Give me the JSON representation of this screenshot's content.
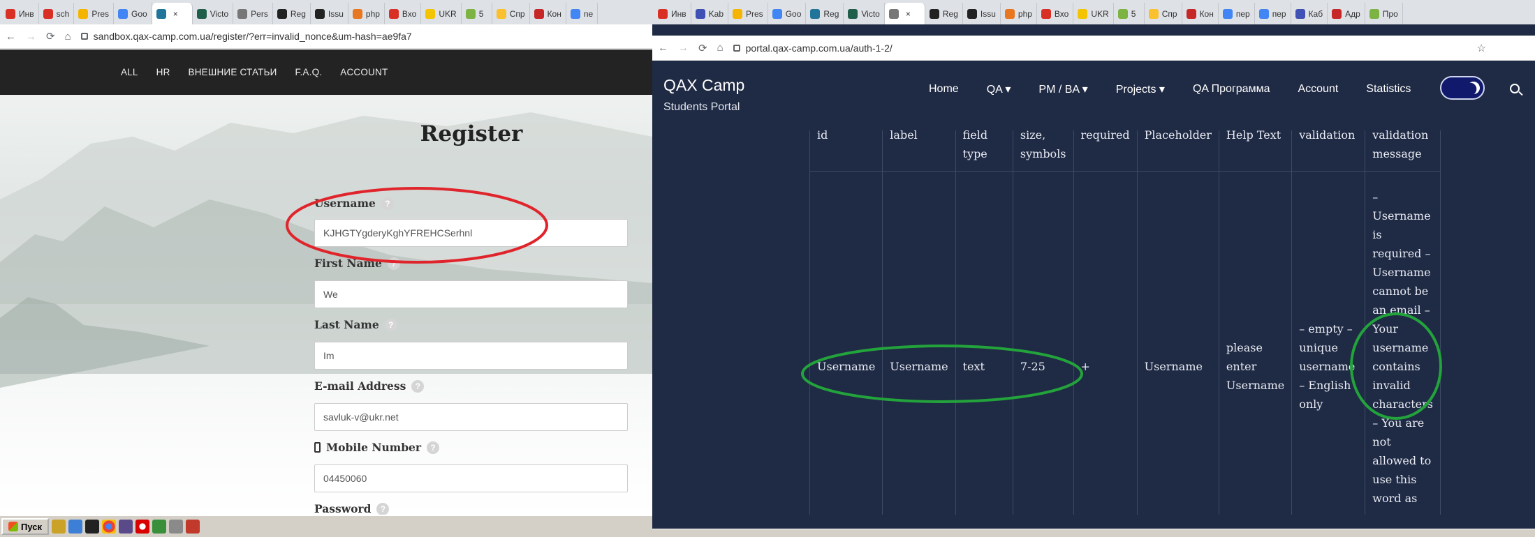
{
  "left_window": {
    "tabs": [
      {
        "label": "Инв",
        "color": "#d93025"
      },
      {
        "label": "sch",
        "color": "#d93025"
      },
      {
        "label": "Pres",
        "color": "#f4b400"
      },
      {
        "label": "Goo",
        "color": "#4285f4"
      },
      {
        "label": "",
        "color": "#21759b"
      },
      {
        "label": "Victo",
        "color": "#1f5f4a"
      },
      {
        "label": "Pers",
        "color": "#777"
      },
      {
        "label": "Reg",
        "color": "#222"
      },
      {
        "label": "Issu",
        "color": "#222"
      },
      {
        "label": "php",
        "color": "#e87722"
      },
      {
        "label": "Вхо",
        "color": "#d93025"
      },
      {
        "label": "UKR",
        "color": "#f5c400"
      },
      {
        "label": "5",
        "color": "#7cb342"
      },
      {
        "label": "Спр",
        "color": "#fbc02d"
      },
      {
        "label": "Кон",
        "color": "#c62828"
      },
      {
        "label": "ne",
        "color": "#4285f4"
      }
    ],
    "url": "sandbox.qax-camp.com.ua/register/?err=invalid_nonce&um-hash=ae9fa7",
    "nav": [
      "ALL",
      "HR",
      "ВНЕШНИЕ СТАТЬИ",
      "F.A.Q.",
      "ACCOUNT"
    ],
    "form": {
      "title": "Register",
      "username_label": "Username",
      "username_value": "KJHGTYgderyKghYFREHCSerhnl",
      "first_name_label": "First Name",
      "first_name_value": "We",
      "last_name_label": "Last Name",
      "last_name_value": "Im",
      "email_label": "E-mail Address",
      "email_value": "savluk-v@ukr.net",
      "mobile_label": "Mobile Number",
      "mobile_value": "04450060",
      "password_label": "Password",
      "help_glyph": "?"
    },
    "taskbar": {
      "start_label": "Пуск"
    }
  },
  "right_window": {
    "tabs": [
      {
        "label": "Инв",
        "color": "#d93025"
      },
      {
        "label": "Kab",
        "color": "#3f51b5"
      },
      {
        "label": "Pres",
        "color": "#f4b400"
      },
      {
        "label": "Goo",
        "color": "#4285f4"
      },
      {
        "label": "Reg",
        "color": "#21759b"
      },
      {
        "label": "Victo",
        "color": "#1f5f4a"
      },
      {
        "label": "",
        "color": "#777"
      },
      {
        "label": "Reg",
        "color": "#222"
      },
      {
        "label": "Issu",
        "color": "#222"
      },
      {
        "label": "php",
        "color": "#e87722"
      },
      {
        "label": "Вхо",
        "color": "#d93025"
      },
      {
        "label": "UKR",
        "color": "#f5c400"
      },
      {
        "label": "5",
        "color": "#7cb342"
      },
      {
        "label": "Спр",
        "color": "#fbc02d"
      },
      {
        "label": "Кон",
        "color": "#c62828"
      },
      {
        "label": "пер",
        "color": "#4285f4"
      },
      {
        "label": "пер",
        "color": "#4285f4"
      },
      {
        "label": "Каб",
        "color": "#3f51b5"
      },
      {
        "label": "Адр",
        "color": "#c62828"
      },
      {
        "label": "Про",
        "color": "#7cb342"
      }
    ],
    "url": "portal.qax-camp.com.ua/auth-1-2/",
    "brand": "QAX Camp",
    "tagline": "Students Portal",
    "nav": [
      "Home",
      "QA ▾",
      "PM / BA ▾",
      "Projects ▾",
      "QA Программа",
      "Account",
      "Statistics"
    ],
    "table": {
      "headers": [
        "id",
        "label",
        "field type",
        "size, symbols",
        "required",
        "Placeholder",
        "Help Text",
        "validation",
        "validation message"
      ],
      "row": {
        "id": "Username",
        "label": "Username",
        "field_type": "text",
        "size": "7-25",
        "required": "+",
        "placeholder": "Username",
        "help_text": "please enter Username",
        "validation": "– empty – unique username – English only",
        "validation_message": "– Username is required – Username cannot be an email – Your username contains invalid characters – You are not allowed to use this word as your username"
      }
    },
    "annotation_colors": {
      "left": "#e0242b",
      "right": "#23a33b"
    }
  }
}
